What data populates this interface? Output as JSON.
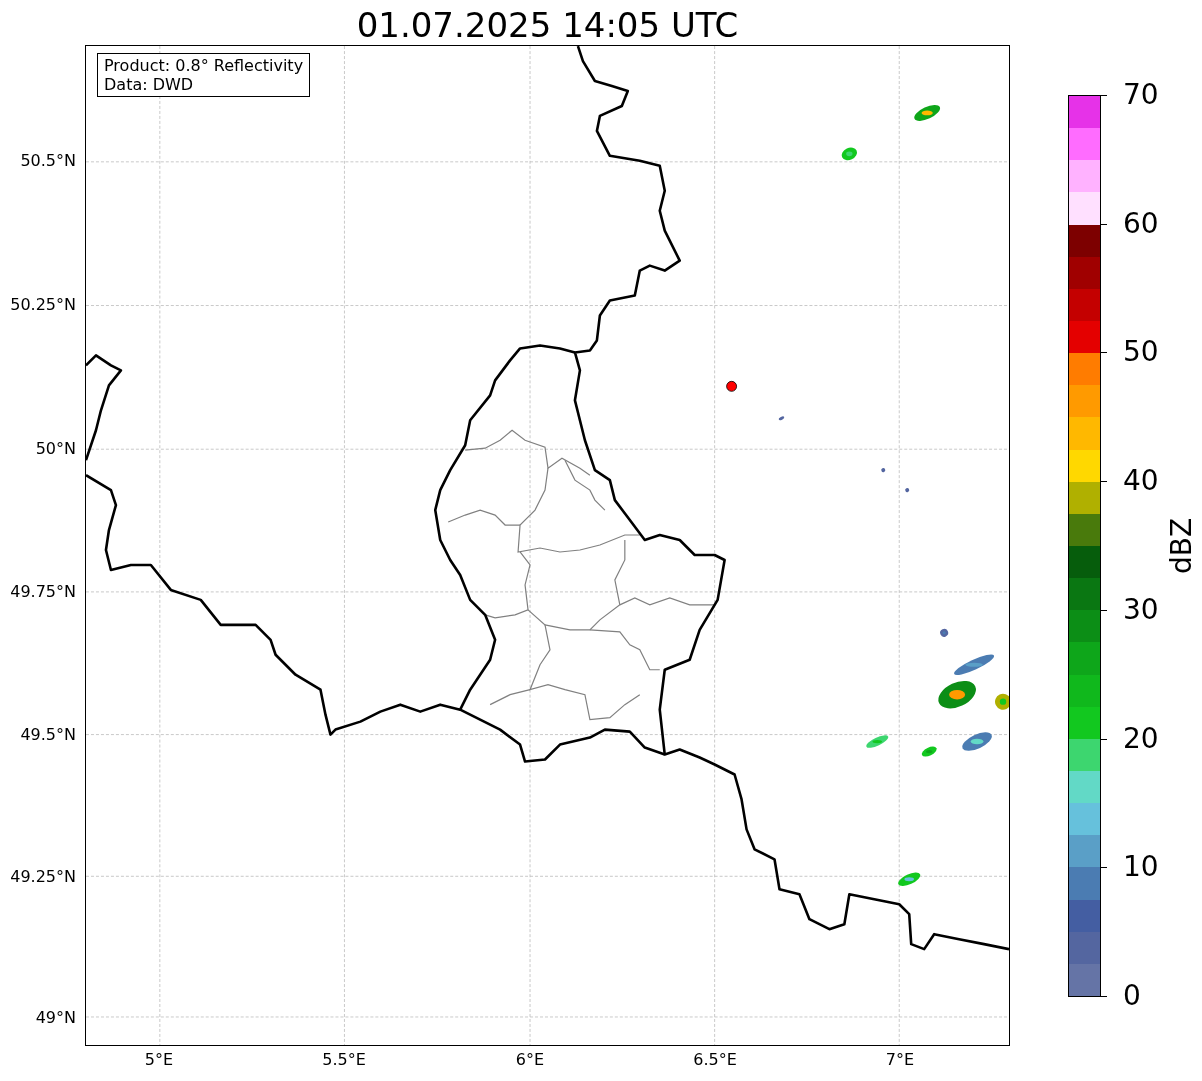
{
  "title": "01.07.2025 14:05 UTC",
  "info_box": [
    "Product: 0.8° Reflectivity",
    "Data: DWD"
  ],
  "map": {
    "lat_labels": [
      "50.5°N",
      "50.25°N",
      "50°N",
      "49.75°N",
      "49.5°N",
      "49.25°N",
      "49°N"
    ],
    "lon_labels": [
      "5°E",
      "5.5°E",
      "6°E",
      "6.5°E",
      "7°E"
    ]
  },
  "colorbar": {
    "label": "dBZ",
    "ticks": [
      "70",
      "60",
      "50",
      "40",
      "30",
      "20",
      "10",
      "0"
    ],
    "segments": [
      {
        "color": "#e632e8"
      },
      {
        "color": "#ff6cff"
      },
      {
        "color": "#ffb2ff"
      },
      {
        "color": "#ffe0ff"
      },
      {
        "color": "#7d0000"
      },
      {
        "color": "#a00000"
      },
      {
        "color": "#c40000"
      },
      {
        "color": "#e40000"
      },
      {
        "color": "#ff7c00"
      },
      {
        "color": "#ff9a00"
      },
      {
        "color": "#ffb800"
      },
      {
        "color": "#ffd800"
      },
      {
        "color": "#b0b000"
      },
      {
        "color": "#497a0c"
      },
      {
        "color": "#065d0c"
      },
      {
        "color": "#0a7712"
      },
      {
        "color": "#0c8e16"
      },
      {
        "color": "#0ea61a"
      },
      {
        "color": "#10b81c"
      },
      {
        "color": "#12c81f"
      },
      {
        "color": "#3dd66f"
      },
      {
        "color": "#62d9c6"
      },
      {
        "color": "#66c1dc"
      },
      {
        "color": "#5a9fc7"
      },
      {
        "color": "#4b7cb2"
      },
      {
        "color": "#445ea2"
      },
      {
        "color": "#5466a0"
      },
      {
        "color": "#6574a6"
      }
    ]
  }
}
